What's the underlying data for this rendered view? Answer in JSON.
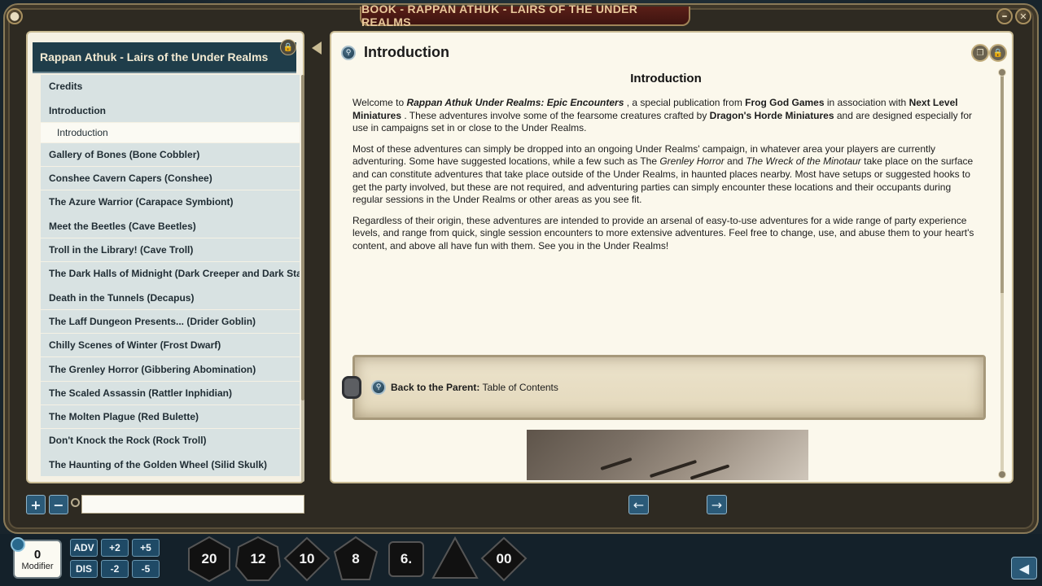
{
  "window": {
    "title": "BOOK - RAPPAN ATHUK - LAIRS OF THE UNDER REALMS",
    "minimize_glyph": "–",
    "close_glyph": "✕"
  },
  "sidebar": {
    "header": "Rappan Athuk - Lairs of the Under Realms",
    "lock_glyph": "🔒",
    "items": [
      {
        "label": "Credits"
      },
      {
        "label": "Introduction"
      },
      {
        "label": "Introduction",
        "sub": true
      },
      {
        "label": "Gallery of Bones (Bone Cobbler)"
      },
      {
        "label": "Conshee Cavern Capers (Conshee)"
      },
      {
        "label": "The Azure Warrior  (Carapace Symbiont)"
      },
      {
        "label": "Meet the Beetles  (Cave Beetles)"
      },
      {
        "label": "Troll in the Library!  (Cave Troll)"
      },
      {
        "label": "The Dark Halls of Midnight  (Dark Creeper and Dark Stalker)"
      },
      {
        "label": "Death in the Tunnels  (Decapus)"
      },
      {
        "label": "The Laff Dungeon Presents...  (Drider Goblin)"
      },
      {
        "label": "Chilly Scenes of Winter  (Frost Dwarf)"
      },
      {
        "label": "The Grenley Horror  (Gibbering Abomination)"
      },
      {
        "label": "The Scaled Assassin  (Rattler Inphidian)"
      },
      {
        "label": "The Molten Plague  (Red Bulette)"
      },
      {
        "label": "Don't Knock the Rock  (Rock Troll)"
      },
      {
        "label": "The Haunting of the Golden Wheel  (Silid Skulk)"
      }
    ]
  },
  "page": {
    "title": "Introduction",
    "heading": "Introduction",
    "p1": {
      "a": "Welcome to ",
      "b": "Rappan Athuk Under Realms: Epic Encounters",
      "c": " , a special publication from ",
      "d": "Frog God Games",
      "e": " in association with ",
      "f": "Next Level Miniatures",
      "g": " . These adventures involve some of the fearsome creatures crafted by ",
      "h": "Dragon's Horde Miniatures",
      "i": " and are designed especially for use in campaigns set in or close to the Under Realms."
    },
    "p2": {
      "a": "Most of these adventures can simply be dropped into an ongoing Under Realms' campaign, in whatever area your players are currently adventuring. Some have suggested locations, while a few such as The ",
      "b": "Grenley Horror",
      "c": " and ",
      "d": "The Wreck of the Minotaur",
      "e": " take place on the surface and can constitute adventures that take place outside of the Under Realms, in haunted places nearby. Most have setups or suggested hooks to get the party involved, but these are not required, and adventuring parties can simply encounter these locations and their occupants during regular sessions in the Under Realms or other areas as you see fit."
    },
    "p3": "Regardless of their origin, these adventures are intended to provide an arsenal of easy-to-use adventures for a wide range of party experience levels, and range from quick, single session encounters to more extensive adventures. Feel free to change, use, and abuse them to your heart's content, and above all have fun with them. See you in the Under Realms!",
    "parent_label": "Back to the Parent:",
    "parent_target": "Table of Contents"
  },
  "controls": {
    "add": "+",
    "remove": "−",
    "search_value": "",
    "prev": "←",
    "next": "→"
  },
  "hotbar": {
    "modifier_value": "0",
    "modifier_label": "Modifier",
    "adv": "ADV",
    "dis": "DIS",
    "plus2": "+2",
    "plus5": "+5",
    "minus2": "-2",
    "minus5": "-5",
    "dice": [
      "20",
      "12",
      "10",
      "8",
      "6.",
      "",
      "00"
    ],
    "back": "◀"
  }
}
